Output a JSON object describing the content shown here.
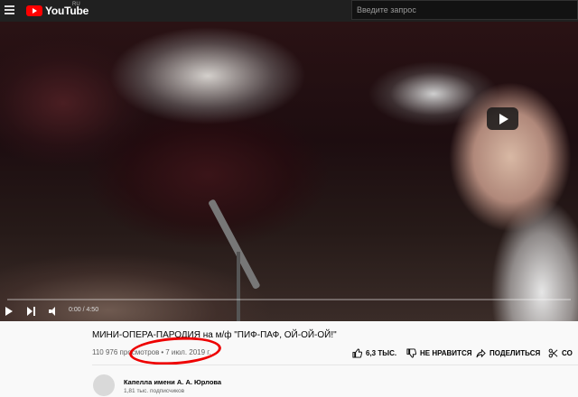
{
  "header": {
    "logo_text": "YouTube",
    "region": "RU",
    "search_placeholder": "Введите запрос"
  },
  "player": {
    "time": "0:00 / 4:50",
    "progress": 0
  },
  "video": {
    "title": "МИНИ-ОПЕРА-ПАРОДИЯ на м/ф \"ПИФ-ПАФ, ОЙ-ОЙ-ОЙ!\"",
    "views": "110 976 просмотров",
    "date": "7 июл. 2019 г."
  },
  "actions": {
    "like": "6,3 ТЫС.",
    "dislike": "НЕ НРАВИТСЯ",
    "share": "ПОДЕЛИТЬСЯ",
    "save": "СО"
  },
  "channel": {
    "name": "Капелла имени А. А. Юрлова",
    "subscribers": "1,81 тыс. подписчиков"
  },
  "colors": {
    "brand": "#ff0000",
    "topbar": "#202020",
    "highlight_circle": "#ee0000"
  }
}
